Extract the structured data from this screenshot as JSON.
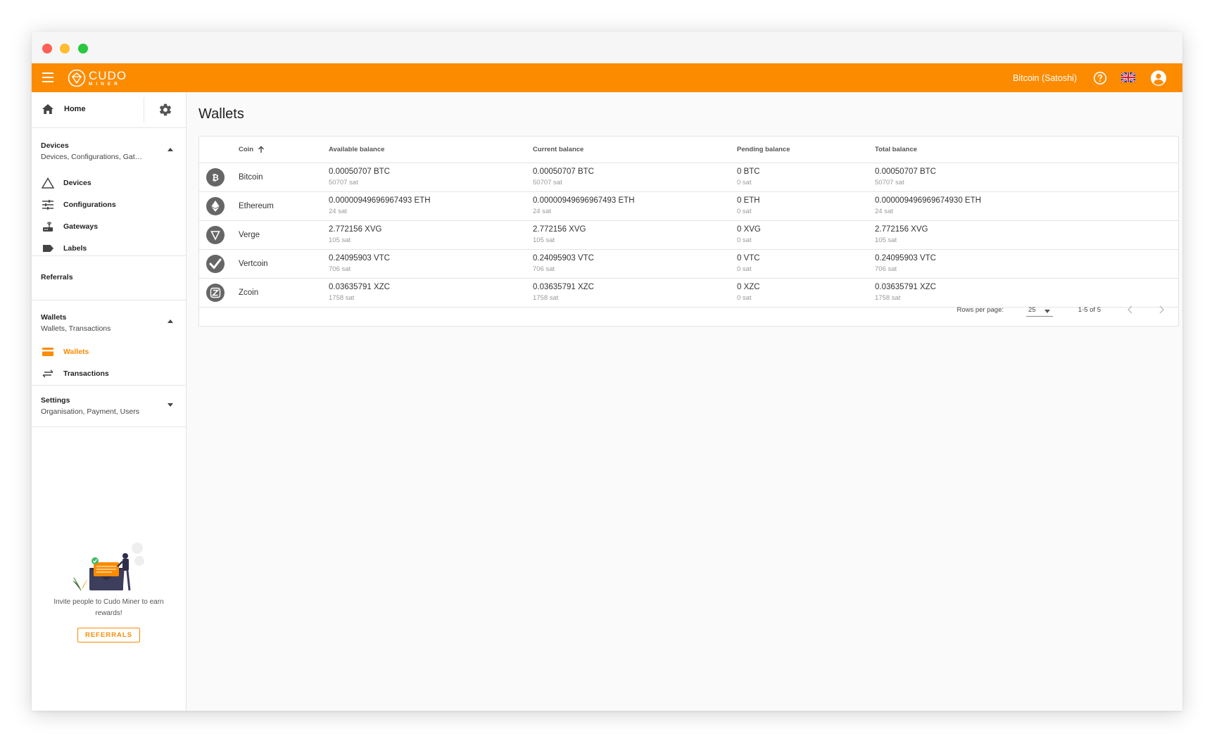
{
  "topbar": {
    "logo_text": "CUDO",
    "logo_subtext": "MINER",
    "currency": "Bitcoin (Satoshi)"
  },
  "sidebar": {
    "home_label": "Home",
    "devices": {
      "title": "Devices",
      "subtitle": "Devices, Configurations, Gateways, Labels",
      "items": [
        {
          "label": "Devices",
          "icon": "triangle-outline-icon"
        },
        {
          "label": "Configurations",
          "icon": "sliders-icon"
        },
        {
          "label": "Gateways",
          "icon": "router-icon"
        },
        {
          "label": "Labels",
          "icon": "label-icon"
        }
      ]
    },
    "referrals": {
      "title": "Referrals"
    },
    "wallets": {
      "title": "Wallets",
      "subtitle": "Wallets, Transactions",
      "items": [
        {
          "label": "Wallets",
          "icon": "wallet-icon",
          "active": true
        },
        {
          "label": "Transactions",
          "icon": "swap-arrows-icon"
        }
      ]
    },
    "settings": {
      "title": "Settings",
      "subtitle": "Organisation, Payment, Users"
    },
    "promo": {
      "text": "Invite people to Cudo Miner to earn rewards!",
      "button": "REFERRALS"
    }
  },
  "main": {
    "title": "Wallets",
    "table": {
      "headers": {
        "coin": "Coin",
        "available": "Available balance",
        "current": "Current balance",
        "pending": "Pending balance",
        "total": "Total balance"
      },
      "rows": [
        {
          "coin": "Bitcoin",
          "icon": "bitcoin-icon",
          "available": "0.00050707 BTC",
          "available_sat": "50707 sat",
          "current": "0.00050707 BTC",
          "current_sat": "50707 sat",
          "pending": "0 BTC",
          "pending_sat": "0 sat",
          "total": "0.00050707 BTC",
          "total_sat": "50707 sat"
        },
        {
          "coin": "Ethereum",
          "icon": "ethereum-icon",
          "available": "0.00000949696967493 ETH",
          "available_sat": "24 sat",
          "current": "0.00000949696967493 ETH",
          "current_sat": "24 sat",
          "pending": "0 ETH",
          "pending_sat": "0 sat",
          "total": "0.000009496969674930 ETH",
          "total_sat": "24 sat"
        },
        {
          "coin": "Verge",
          "icon": "verge-icon",
          "available": "2.772156 XVG",
          "available_sat": "105 sat",
          "current": "2.772156 XVG",
          "current_sat": "105 sat",
          "pending": "0 XVG",
          "pending_sat": "0 sat",
          "total": "2.772156 XVG",
          "total_sat": "105 sat"
        },
        {
          "coin": "Vertcoin",
          "icon": "vertcoin-icon",
          "available": "0.24095903 VTC",
          "available_sat": "706 sat",
          "current": "0.24095903 VTC",
          "current_sat": "706 sat",
          "pending": "0 VTC",
          "pending_sat": "0 sat",
          "total": "0.24095903 VTC",
          "total_sat": "706 sat"
        },
        {
          "coin": "Zcoin",
          "icon": "zcoin-icon",
          "available": "0.03635791 XZC",
          "available_sat": "1758 sat",
          "current": "0.03635791 XZC",
          "current_sat": "1758 sat",
          "pending": "0 XZC",
          "pending_sat": "0 sat",
          "total": "0.03635791 XZC",
          "total_sat": "1758 sat"
        }
      ]
    },
    "pagination": {
      "rows_per_page_label": "Rows per page:",
      "rows_per_page": "25",
      "range": "1-5 of 5"
    }
  },
  "colors": {
    "accent": "#fc8b00",
    "coin_icon": "#666666"
  }
}
